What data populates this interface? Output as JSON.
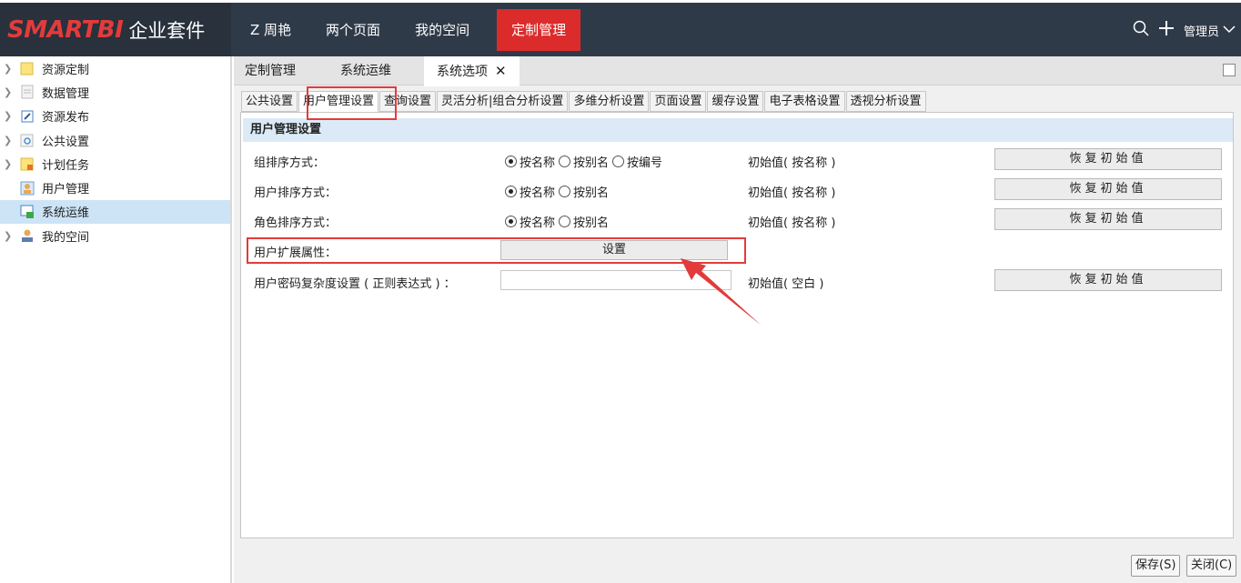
{
  "header": {
    "brand": "SMARTBI",
    "suite": "企业套件",
    "nav": [
      {
        "label": "Z 周艳"
      },
      {
        "label": "两个页面"
      },
      {
        "label": "我的空间"
      },
      {
        "label": "定制管理"
      }
    ],
    "user": "管理员"
  },
  "sidebar": {
    "items": [
      {
        "label": "资源定制",
        "icon": "folder-icon"
      },
      {
        "label": "数据管理",
        "icon": "document-icon"
      },
      {
        "label": "资源发布",
        "icon": "publish-icon"
      },
      {
        "label": "公共设置",
        "icon": "settings-icon"
      },
      {
        "label": "计划任务",
        "icon": "schedule-icon"
      },
      {
        "label": "用户管理",
        "icon": "user-manage-icon"
      },
      {
        "label": "系统运维",
        "icon": "system-ops-icon"
      },
      {
        "label": "我的空间",
        "icon": "my-space-icon"
      }
    ]
  },
  "tabs": [
    {
      "label": "定制管理"
    },
    {
      "label": "系统运维"
    },
    {
      "label": "系统选项",
      "close": "✕"
    }
  ],
  "subtabs": [
    {
      "label": "公共设置"
    },
    {
      "label": "用户管理设置"
    },
    {
      "label": "查询设置"
    },
    {
      "label": "灵活分析|组合分析设置"
    },
    {
      "label": "多维分析设置"
    },
    {
      "label": "页面设置"
    },
    {
      "label": "缓存设置"
    },
    {
      "label": "电子表格设置"
    },
    {
      "label": "透视分析设置"
    }
  ],
  "panel": {
    "title": "用户管理设置",
    "rows": {
      "group_sort": {
        "label": "组排序方式：",
        "options": [
          "按名称",
          "按别名",
          "按编号"
        ],
        "init": "初始值( 按名称 )",
        "restore": "恢复初始值"
      },
      "user_sort": {
        "label": "用户排序方式：",
        "options": [
          "按名称",
          "按别名"
        ],
        "init": "初始值( 按名称 )",
        "restore": "恢复初始值"
      },
      "role_sort": {
        "label": "角色排序方式：",
        "options": [
          "按名称",
          "按别名"
        ],
        "init": "初始值( 按名称 )",
        "restore": "恢复初始值"
      },
      "ext_attr": {
        "label": "用户扩展属性：",
        "button": "设置"
      },
      "pwd": {
        "label": "用户密码复杂度设置 ( 正则表达式 ) ：",
        "value": "",
        "init": "初始值( 空白 )",
        "restore": "恢复初始值"
      }
    }
  },
  "footer": {
    "save": "保存(S)",
    "close": "关闭(C)"
  },
  "colors": {
    "topbar": "#2f3a48",
    "accent": "#dc2b2b",
    "sidebar_selected": "#cde4f7",
    "panel_header": "#dceaf7",
    "annotation": "#e23b3b"
  }
}
